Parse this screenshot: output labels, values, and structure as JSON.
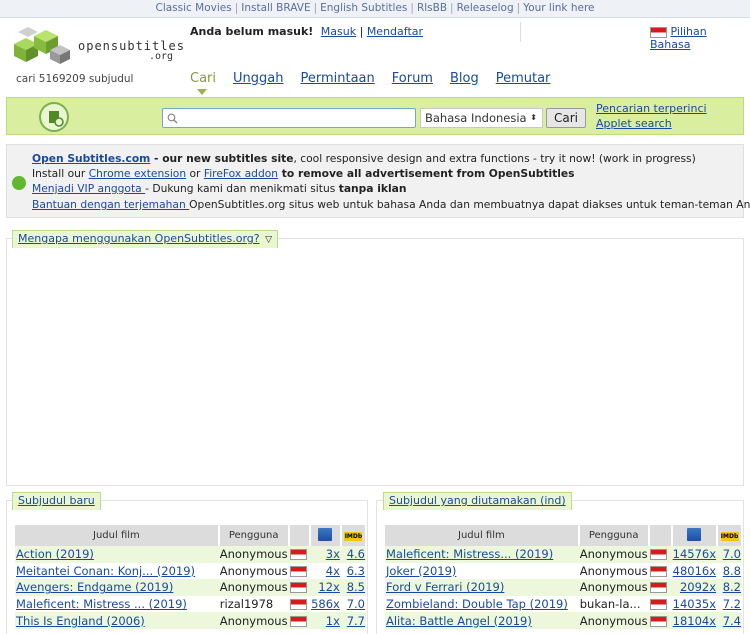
{
  "topbar": {
    "links": [
      "Classic Movies",
      "Install BRAVE",
      "English Subtitles",
      "RlsBB",
      "Releaselog",
      "Your link here"
    ]
  },
  "logo": {
    "text1": "opensubtitles",
    "text2": ".org"
  },
  "header": {
    "not_logged": "Anda belum masuk!",
    "login": "Masuk",
    "register": "Mendaftar",
    "lang_pick": "Pilihan Bahasa",
    "count": "cari 5169209 subjudul"
  },
  "nav": [
    "Cari",
    "Unggah",
    "Permintaan",
    "Forum",
    "Blog",
    "Pemutar"
  ],
  "search": {
    "placeholder": "",
    "language": "Bahasa Indonesia",
    "button": "Cari",
    "advanced": "Pencarian terperinci",
    "applet": "Applet search"
  },
  "notice": {
    "l1_link": "Open Subtitles.com",
    "l1_bold": " - our new subtitles site",
    "l1_rest": ", cool responsive design and extra functions - try it now! (work in progress)",
    "l2_pre": "Install our ",
    "l2_link1": "Chrome extension",
    "l2_mid": " or ",
    "l2_link2": "FireFox addon",
    "l2_bold": " to remove all advertisement from OpenSubtitles",
    "l3_link": "Menjadi VIP anggota ",
    "l3_rest": "- Dukung kami dan menikmati situs ",
    "l3_bold": "tanpa iklan",
    "l4_link": "Bantuan dengan terjemahan ",
    "l4_rest": "OpenSubtitles.org situs web untuk bahasa Anda dan membuatnya dapat diakses untuk teman-teman Anda."
  },
  "why": {
    "label": "Mengapa menggunakan OpenSubtitles.org?"
  },
  "latest": {
    "title": "Subjudul baru",
    "headers": [
      "Judul film",
      "Pengguna"
    ],
    "rows": [
      {
        "title": "Action (2019)",
        "user": "Anonymous",
        "count": "3x",
        "rating": "4.6"
      },
      {
        "title": "Meitantei Conan: Konj... (2019)",
        "user": "Anonymous",
        "count": "4x",
        "rating": "6.3"
      },
      {
        "title": "Avengers: Endgame (2019)",
        "user": "Anonymous",
        "count": "12x",
        "rating": "8.5"
      },
      {
        "title": "Maleficent: Mistress ... (2019)",
        "user": "rizal1978",
        "count": "586x",
        "rating": "7.0"
      },
      {
        "title": "This Is England (2006)",
        "user": "Anonymous",
        "count": "1x",
        "rating": "7.7"
      }
    ]
  },
  "featured": {
    "title": "Subjudul yang diutamakan (ind)",
    "headers": [
      "Judul film",
      "Pengguna"
    ],
    "rows": [
      {
        "title": "Maleficent: Mistress... (2019)",
        "user": "Anonymous",
        "count": "14576x",
        "rating": "7.0"
      },
      {
        "title": "Joker (2019)",
        "user": "Anonymous",
        "count": "48016x",
        "rating": "8.8"
      },
      {
        "title": "Ford v Ferrari (2019)",
        "user": "Anonymous",
        "count": "2092x",
        "rating": "8.2"
      },
      {
        "title": "Zombieland: Double Tap (2019)",
        "user": "bukan-la...",
        "count": "14035x",
        "rating": "7.2"
      },
      {
        "title": "Alita: Battle Angel (2019)",
        "user": "Anonymous",
        "count": "18104x",
        "rating": "7.4"
      }
    ]
  }
}
